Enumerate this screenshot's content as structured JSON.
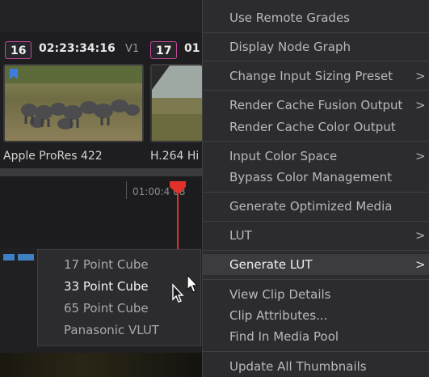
{
  "clips": [
    {
      "number": "16",
      "timecode": "02:23:34:16",
      "track": "V1",
      "codec": "Apple ProRes 422"
    },
    {
      "number": "17",
      "timecode": "01",
      "codec": "H.264 Hi"
    }
  ],
  "timeline": {
    "timecode": "01:00:4 08"
  },
  "context_menu": {
    "items": [
      {
        "label": "Use Remote Grades"
      },
      {
        "label": "Display Node Graph"
      },
      {
        "label": "Change Input Sizing Preset",
        "submenu": ">"
      },
      {
        "label": "Render Cache Fusion Output",
        "submenu": ">"
      },
      {
        "label": "Render Cache Color Output"
      },
      {
        "label": "Input Color Space",
        "submenu": ">"
      },
      {
        "label": "Bypass Color Management"
      },
      {
        "label": "Generate Optimized Media"
      },
      {
        "label": "LUT",
        "submenu": ">"
      },
      {
        "label": "Generate LUT",
        "submenu": ">",
        "highlighted": true
      },
      {
        "label": "View Clip Details"
      },
      {
        "label": "Clip Attributes..."
      },
      {
        "label": "Find In Media Pool"
      },
      {
        "label": "Update All Thumbnails"
      }
    ]
  },
  "lut_submenu": {
    "items": [
      {
        "label": "17 Point Cube"
      },
      {
        "label": "33 Point Cube",
        "highlighted": true
      },
      {
        "label": "65 Point Cube"
      },
      {
        "label": "Panasonic VLUT"
      }
    ]
  },
  "colors": {
    "playhead": "#e0312b",
    "clip_badge_border": "#c84a9e",
    "menu_bg": "#2c2c2f",
    "menu_highlight": "#3c3c40",
    "track_clip": "#3f7fc4"
  },
  "icons": {
    "cursor": "arrow-pointer-icon",
    "flag": "bookmark-flag-icon"
  }
}
